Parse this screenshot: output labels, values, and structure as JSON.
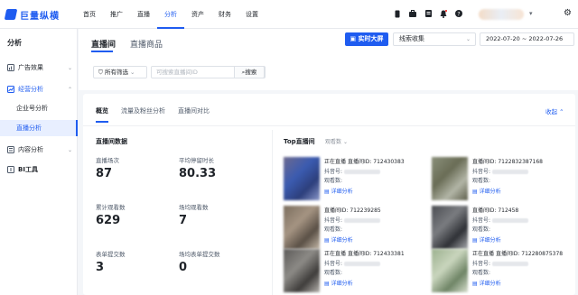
{
  "brand": {
    "name": "巨量纵横",
    "color": "#1f5cf0"
  },
  "nav": [
    {
      "label": "首页",
      "active": false
    },
    {
      "label": "推广",
      "active": false
    },
    {
      "label": "直播",
      "active": false
    },
    {
      "label": "分析",
      "active": true
    },
    {
      "label": "资产",
      "active": false
    },
    {
      "label": "财务",
      "active": false
    },
    {
      "label": "设置",
      "active": false
    }
  ],
  "sidebar": {
    "title": "分析",
    "groups": [
      {
        "label": "广告效果",
        "icon": "chart-icon",
        "expanded": false
      },
      {
        "label": "经营分析",
        "icon": "trend-icon",
        "expanded": true,
        "items": [
          "企业号分析",
          "直播分析"
        ]
      },
      {
        "label": "内容分析",
        "icon": "content-icon",
        "expanded": false
      },
      {
        "label": "BI工具",
        "icon": "bi-icon",
        "expanded": false
      }
    ],
    "active_item": "直播分析"
  },
  "header": {
    "tabs": [
      "直播间",
      "直播商品"
    ],
    "big_screen": "实时大屏",
    "select_value": "线索收集",
    "date_range": "2022-07-20 ~ 2022-07-26"
  },
  "filter": {
    "label": "所有筛选",
    "search_placeholder": "可搜索直播间ID",
    "search_button": "搜索"
  },
  "card": {
    "tabs": [
      "概览",
      "流量及粉丝分析",
      "直播间对比"
    ],
    "collapse": "收起",
    "section_title": "直播间数据",
    "metrics": [
      {
        "label": "直播场次",
        "value": "87"
      },
      {
        "label": "平均停留时长",
        "value": "80.33"
      },
      {
        "label": "累计观看数",
        "value": "629"
      },
      {
        "label": "场均观看数",
        "value": "7"
      },
      {
        "label": "表单提交数",
        "value": "3"
      },
      {
        "label": "场均表单提交数",
        "value": "0"
      }
    ],
    "top_title": "Top直播间",
    "top_sort": "观看数",
    "rooms": [
      {
        "status": "正在直播",
        "id_label": "直播间ID:",
        "id": "712430383",
        "douyin": "抖音号:",
        "views": "观看数:",
        "detail": "详细分析"
      },
      {
        "status": "",
        "id_label": "直播间ID:",
        "id": "7122832387168",
        "douyin": "抖音号:",
        "views": "观看数:",
        "detail": "详细分析"
      },
      {
        "status": "",
        "id_label": "直播间ID:",
        "id": "712239285",
        "douyin": "抖音号:",
        "views": "观看数:",
        "detail": "详细分析"
      },
      {
        "status": "",
        "id_label": "直播间ID:",
        "id": "712458",
        "douyin": "抖音号:",
        "views": "观看数:",
        "detail": "详细分析"
      },
      {
        "status": "正在直播",
        "id_label": "直播间ID:",
        "id": "712433381",
        "douyin": "抖音号:",
        "views": "观看数:",
        "detail": "详细分析"
      },
      {
        "status": "正在直播",
        "id_label": "直播间ID:",
        "id": "712280875378",
        "douyin": "抖音号:",
        "views": "观看数:",
        "detail": "详细分析"
      }
    ]
  }
}
